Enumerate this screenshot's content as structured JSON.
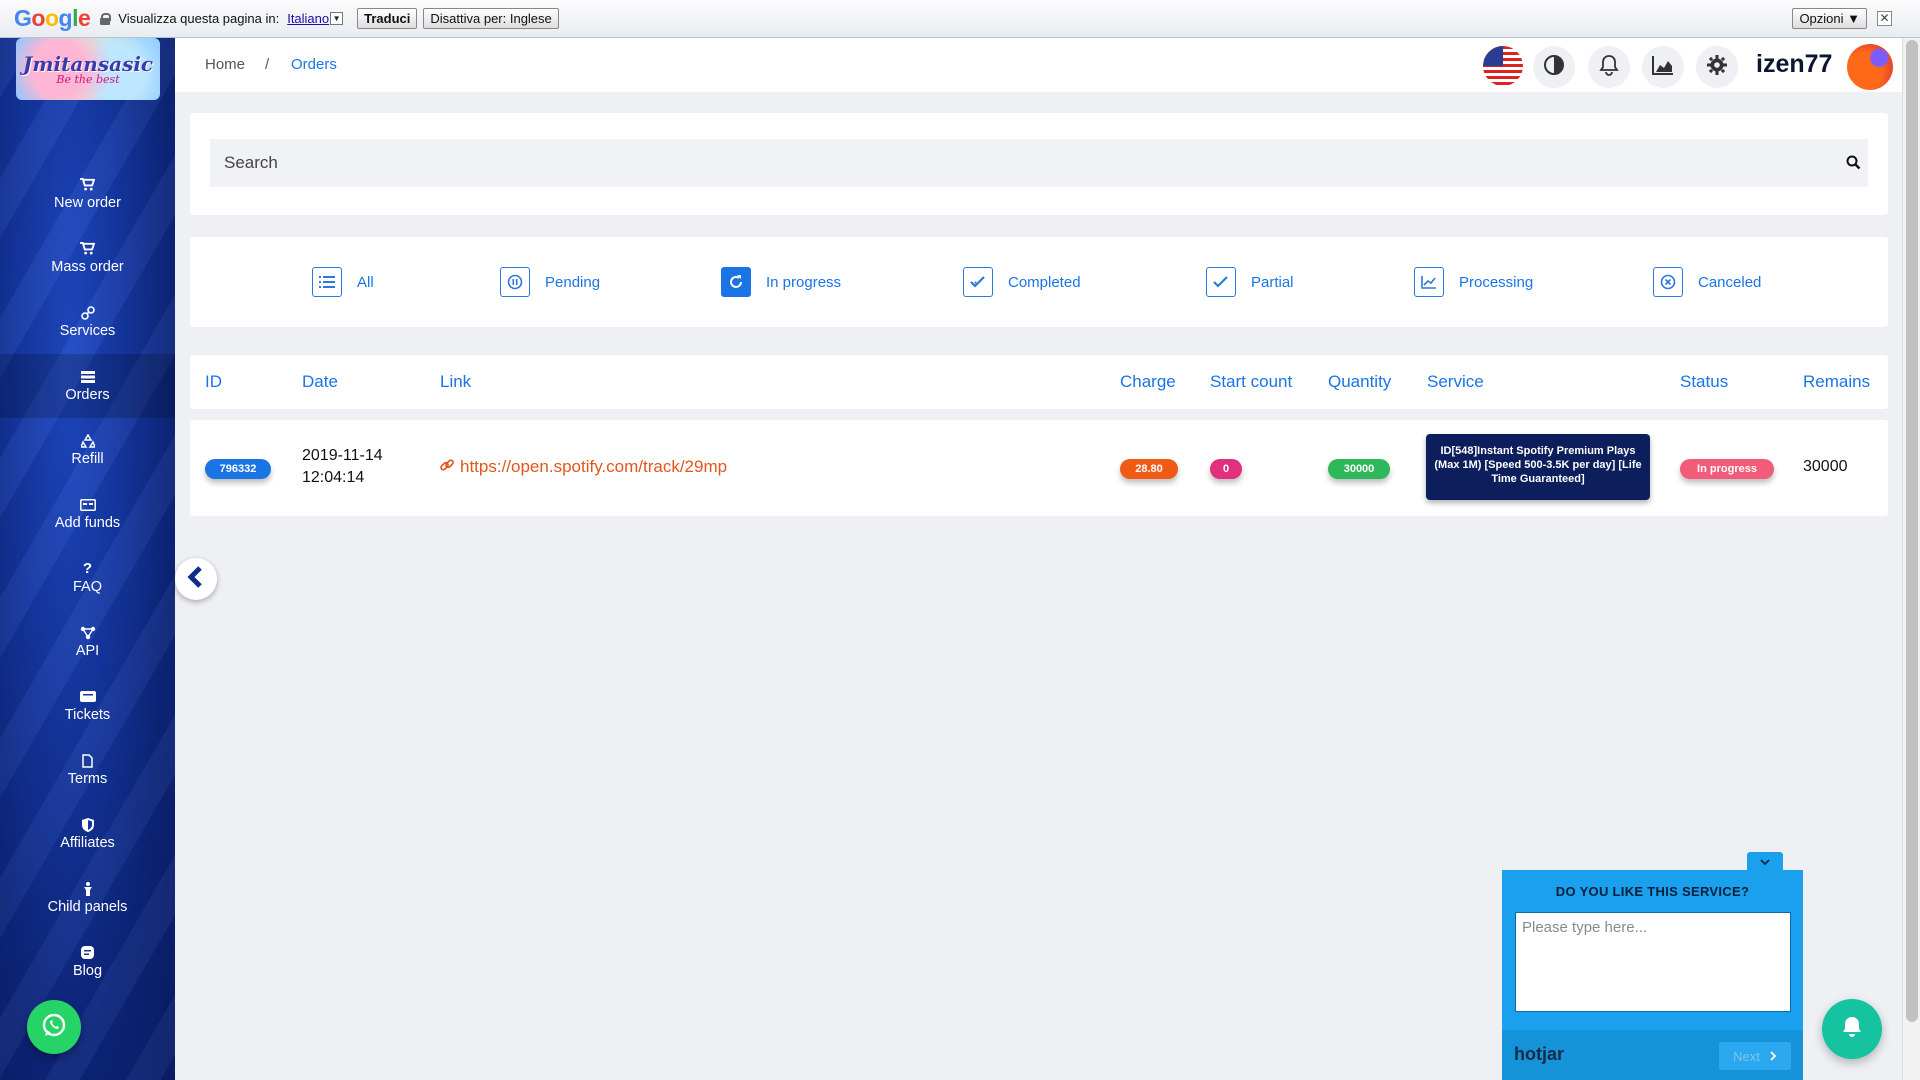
{
  "translate_bar": {
    "logo": [
      "G",
      "o",
      "o",
      "g",
      "l",
      "e"
    ],
    "prompt": "Visualizza questa pagina in:",
    "language": "Italiano",
    "translate_label": "Traduci",
    "disable_label": "Disattiva per: Inglese",
    "options_label": "Opzioni ▼",
    "close_label": "✕"
  },
  "sidebar": {
    "logo_text": "Jmitansasic",
    "logo_tagline": "Be the best",
    "items": [
      {
        "label": "New order",
        "icon": "cart-icon"
      },
      {
        "label": "Mass order",
        "icon": "cart-icon"
      },
      {
        "label": "Services",
        "icon": "link-icon"
      },
      {
        "label": "Orders",
        "icon": "list-icon"
      },
      {
        "label": "Refill",
        "icon": "recycle-icon"
      },
      {
        "label": "Add funds",
        "icon": "card-icon"
      },
      {
        "label": "FAQ",
        "icon": "question-icon"
      },
      {
        "label": "API",
        "icon": "nodes-icon"
      },
      {
        "label": "Tickets",
        "icon": "ticket-icon"
      },
      {
        "label": "Terms",
        "icon": "file-icon"
      },
      {
        "label": "Affiliates",
        "icon": "shield-icon"
      },
      {
        "label": "Child panels",
        "icon": "child-icon"
      },
      {
        "label": "Blog",
        "icon": "blog-icon"
      }
    ],
    "active_index": 3
  },
  "header": {
    "breadcrumb_home": "Home",
    "breadcrumb_sep": "/",
    "breadcrumb_current": "Orders",
    "username": "izen77"
  },
  "search": {
    "placeholder": "Search"
  },
  "filters": [
    {
      "label": "All",
      "icon": "list-icon"
    },
    {
      "label": "Pending",
      "icon": "pause-icon"
    },
    {
      "label": "In progress",
      "icon": "refresh-icon"
    },
    {
      "label": "Completed",
      "icon": "check-double-icon"
    },
    {
      "label": "Partial",
      "icon": "check-icon"
    },
    {
      "label": "Processing",
      "icon": "chart-icon"
    },
    {
      "label": "Canceled",
      "icon": "cancel-icon"
    }
  ],
  "active_filter": "In progress",
  "table": {
    "columns": [
      "ID",
      "Date",
      "Link",
      "Charge",
      "Start count",
      "Quantity",
      "Service",
      "Status",
      "Remains"
    ],
    "rows": [
      {
        "id": "796332",
        "date": "2019-11-14",
        "time": "12:04:14",
        "link": "https://open.spotify.com/track/29mp",
        "charge": "28.80",
        "start_count": "0",
        "quantity": "30000",
        "service": "ID[548]Instant Spotify Premium Plays (Max 1M) [Speed 500-3.5K per day] [Life Time Guaranteed]",
        "status": "In progress",
        "remains": "30000"
      }
    ]
  },
  "feedback": {
    "title": "DO YOU LIKE THIS SERVICE?",
    "placeholder": "Please type here...",
    "brand": "hotjar",
    "next_label": "Next"
  },
  "colors": {
    "accent": "#1b74e4",
    "sidebar": "#1437a2",
    "id_pill": "#1b74e4",
    "charge_pill": "#f05a14",
    "start_pill": "#e0307e",
    "quantity_pill": "#2fb85a",
    "status_pill": "#f25c78",
    "service_badge": "#0c1f5c"
  }
}
